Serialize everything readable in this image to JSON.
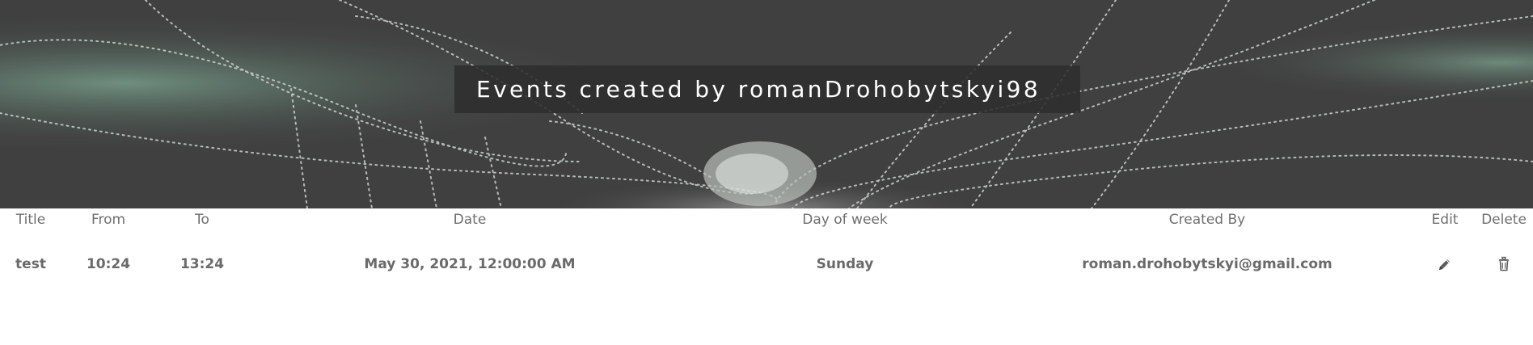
{
  "header": {
    "title": "Events created by romanDrohobytskyi98"
  },
  "table": {
    "columns": {
      "title": "Title",
      "from": "From",
      "to": "To",
      "date": "Date",
      "day_of_week": "Day of week",
      "created_by": "Created By",
      "edit": "Edit",
      "delete": "Delete"
    },
    "rows": [
      {
        "title": "test",
        "from": "10:24",
        "to": "13:24",
        "date": "May 30, 2021, 12:00:00 AM",
        "day_of_week": "Sunday",
        "created_by": "roman.drohobytskyi@gmail.com",
        "edit_icon": "pencil-icon",
        "delete_icon": "trash-icon"
      }
    ]
  },
  "colors": {
    "text": "#6a6a6a",
    "header_text": "#6f6f6f",
    "banner_bg": "#3d3d3d"
  }
}
